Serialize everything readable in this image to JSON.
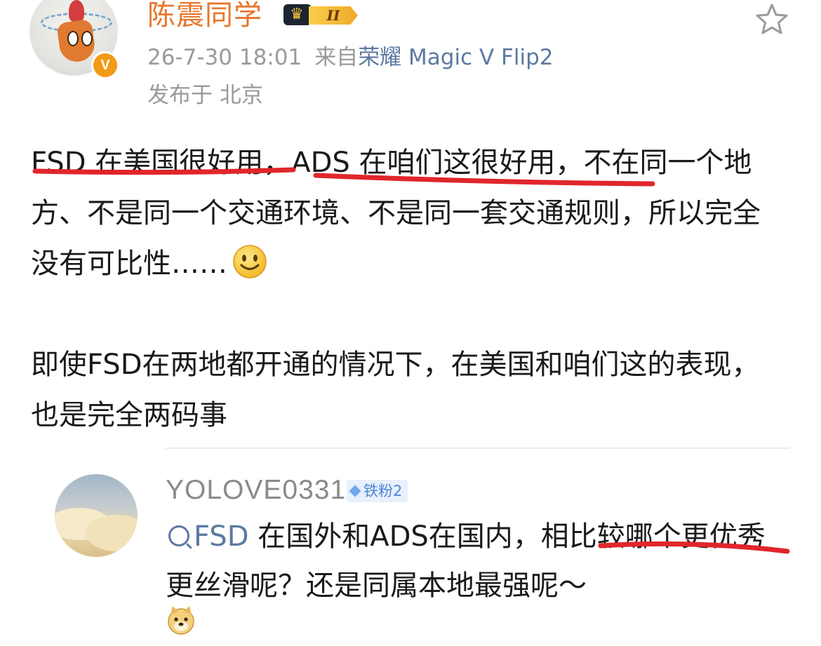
{
  "header": {
    "username": "陈震同学",
    "level_badge": "II",
    "verified_badge": "V",
    "timestamp": "26-7-30 18:01",
    "source_prefix": "来自",
    "source_device": "荣耀 Magic V Flip2",
    "location": "发布于 北京",
    "icons": {
      "avatar": "carrot-avatar",
      "verified": "orange-v-icon",
      "crown": "crown-icon",
      "favorite": "star-outline-icon"
    }
  },
  "post": {
    "paragraph1": "FSD 在美国很好用，ADS 在咱们这很好用，不在同一个地方、不是同一个交通环境、不是同一套交通规则，所以完全没有可比性……",
    "paragraph1_emoji": "smile-emoji",
    "paragraph2": "即使FSD在两地都开通的情况下，在美国和咱们这的表现，也是完全两码事"
  },
  "comment": {
    "username": "YOLOVE0331",
    "fan_badge": "铁粉2",
    "search_link": "FSD",
    "text": " 在国外和ADS在国内，相比较哪个更优秀更丝滑呢？还是同属本地最强呢～",
    "emoji": "doge-emoji",
    "icons": {
      "avatar": "sky-avatar",
      "search": "search-q-icon"
    }
  },
  "colors": {
    "username": "#e8762b",
    "meta_text": "#9a9a9a",
    "link": "#5b7aa0",
    "annotation_underline": "#e0262b",
    "body_text": "#1a1a1a"
  }
}
